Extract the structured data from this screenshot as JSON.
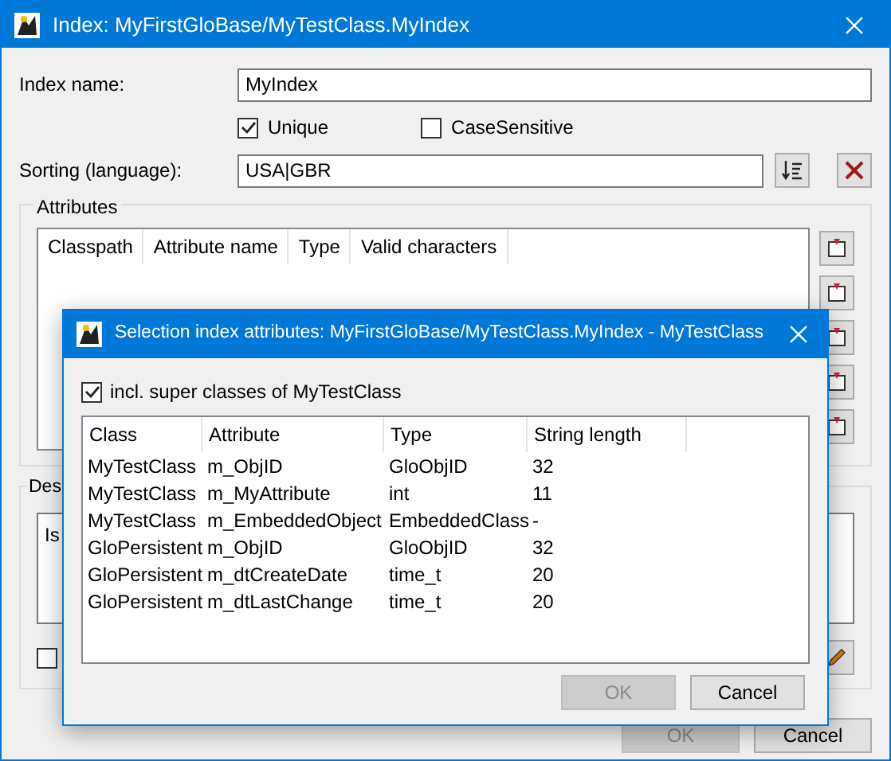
{
  "window": {
    "title": "Index: MyFirstGloBase/MyTestClass.MyIndex"
  },
  "index_name": {
    "label": "Index name:",
    "value": "MyIndex"
  },
  "options": [
    {
      "label": "Unique",
      "checked": true
    },
    {
      "label": "CaseSensitive",
      "checked": false
    }
  ],
  "sorting": {
    "label": "Sorting (language):",
    "value": "USA|GBR"
  },
  "attributes": {
    "title": "Attributes",
    "columns": [
      "Classpath",
      "Attribute name",
      "Type",
      "Valid characters"
    ]
  },
  "description": {
    "title": "Des",
    "text": "Is",
    "checkbox_checked": false
  },
  "buttons": [
    {
      "label": "OK",
      "disabled": true
    },
    {
      "label": "Cancel",
      "disabled": false
    }
  ],
  "dialog": {
    "title": "Selection index attributes: MyFirstGloBase/MyTestClass.MyIndex - MyTestClass",
    "super_classes": {
      "label": "incl. super classes of MyTestClass",
      "checked": true
    },
    "columns": [
      "Class",
      "Attribute",
      "Type",
      "String length"
    ],
    "rows": [
      [
        "MyTestClass",
        "m_ObjID",
        "GloObjID",
        "32"
      ],
      [
        "MyTestClass",
        "m_MyAttribute",
        "int",
        "11"
      ],
      [
        "MyTestClass",
        "m_EmbeddedObject",
        "EmbeddedClass",
        "-"
      ],
      [
        "GloPersistent",
        "m_ObjID",
        "GloObjID",
        "32"
      ],
      [
        "GloPersistent",
        "m_dtCreateDate",
        "time_t",
        "20"
      ],
      [
        "GloPersistent",
        "m_dtLastChange",
        "time_t",
        "20"
      ]
    ],
    "buttons": [
      {
        "label": "OK",
        "disabled": true
      },
      {
        "label": "Cancel",
        "disabled": false
      }
    ]
  }
}
